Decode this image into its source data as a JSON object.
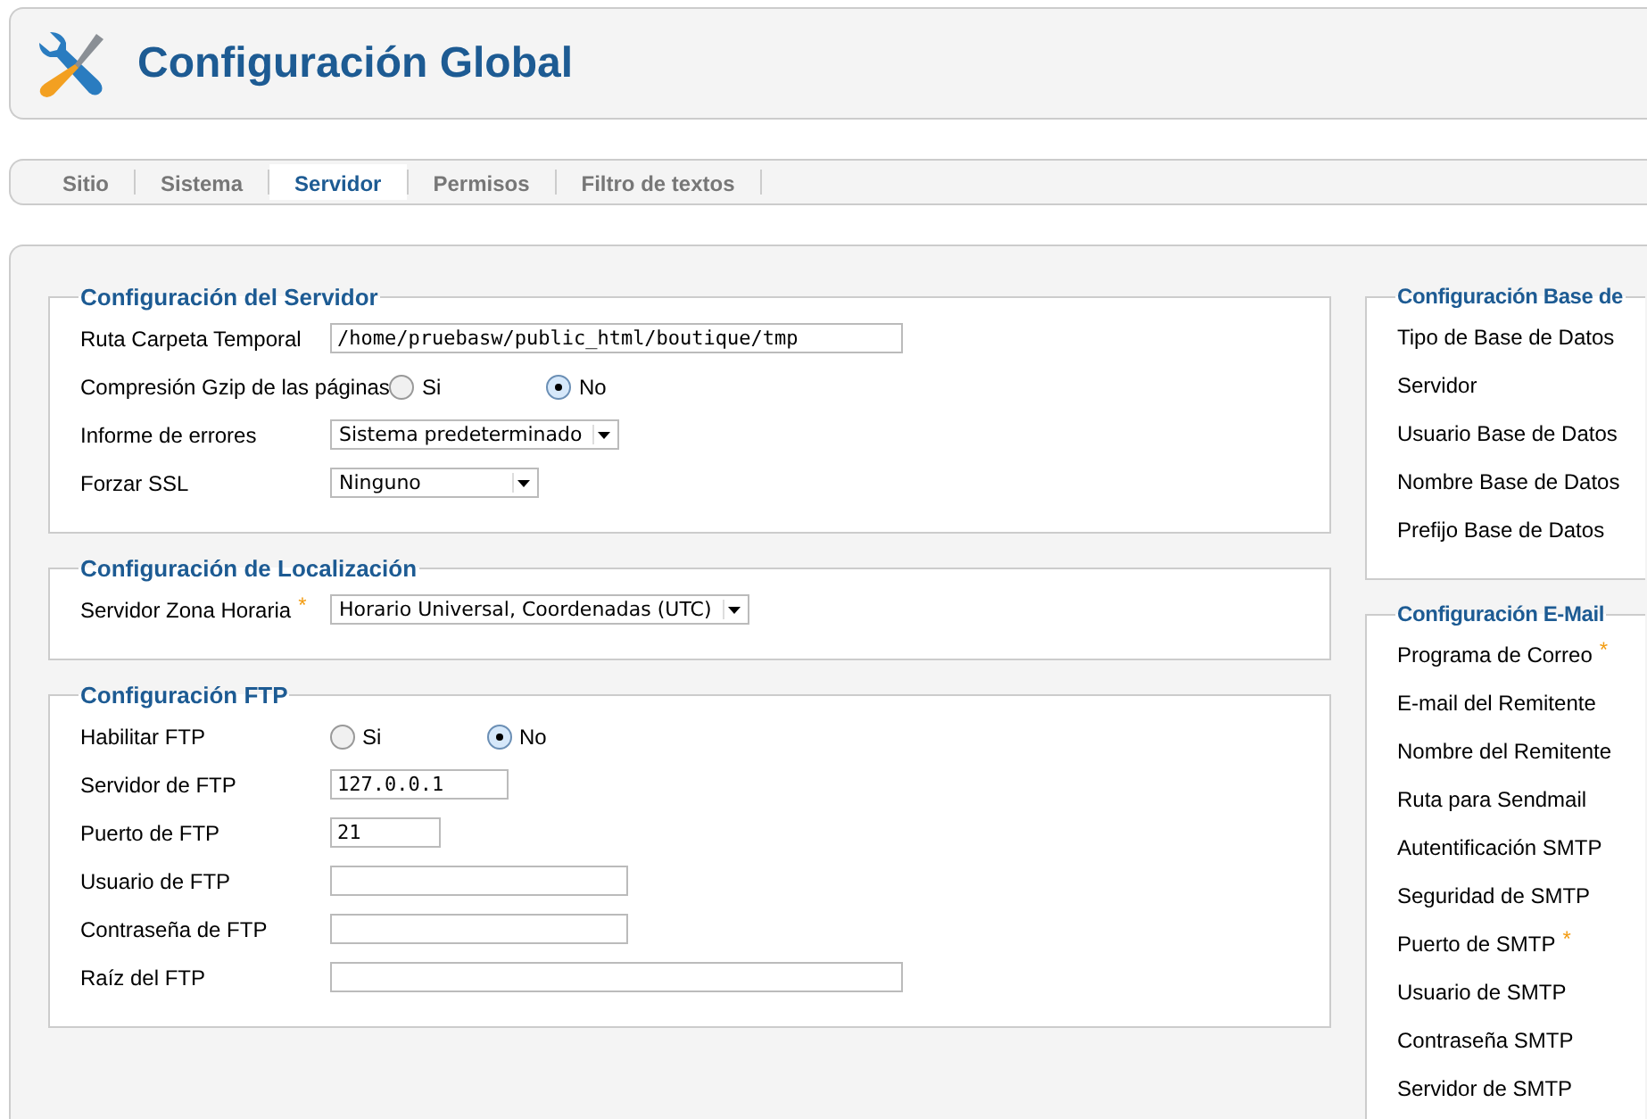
{
  "header": {
    "title": "Configuración Global"
  },
  "tabs": [
    {
      "label": "Sitio",
      "selected": false
    },
    {
      "label": "Sistema",
      "selected": false
    },
    {
      "label": "Servidor",
      "selected": true
    },
    {
      "label": "Permisos",
      "selected": false
    },
    {
      "label": "Filtro de textos",
      "selected": false
    }
  ],
  "left_sections": [
    {
      "legend": "Configuración del Servidor",
      "fields": [
        {
          "kind": "text",
          "label": "Ruta Carpeta Temporal",
          "value": "/home/pruebasw/public_html/boutique/tmp"
        },
        {
          "kind": "radio",
          "label": "Compresión Gzip de las páginas",
          "options": [
            {
              "label": "Si",
              "selected": false
            },
            {
              "label": "No",
              "selected": true
            }
          ]
        },
        {
          "kind": "select",
          "label": "Informe de errores",
          "value": "Sistema predeterminado"
        },
        {
          "kind": "select",
          "label": "Forzar SSL",
          "value": "Ninguno"
        }
      ]
    },
    {
      "legend": "Configuración de Localización",
      "fields": [
        {
          "kind": "select",
          "label": "Servidor Zona Horaria",
          "marker": "*",
          "value": "Horario Universal, Coordenadas (UTC)"
        }
      ]
    },
    {
      "legend": "Configuración FTP",
      "fields": [
        {
          "kind": "radio",
          "label": "Habilitar FTP",
          "options": [
            {
              "label": "Si",
              "selected": false
            },
            {
              "label": "No",
              "selected": true
            }
          ]
        },
        {
          "kind": "text",
          "label": "Servidor de FTP",
          "value": "127.0.0.1"
        },
        {
          "kind": "text",
          "label": "Puerto de FTP",
          "value": "21"
        },
        {
          "kind": "text",
          "label": "Usuario de FTP"
        },
        {
          "kind": "text",
          "label": "Contraseña de FTP"
        },
        {
          "kind": "text",
          "label": "Raíz del FTP"
        }
      ]
    }
  ],
  "right_sections": [
    {
      "legend": "Configuración Base de",
      "fields": [
        {
          "label": "Tipo de Base de Datos"
        },
        {
          "label": "Servidor"
        },
        {
          "label": "Usuario Base de Datos"
        },
        {
          "label": "Nombre Base de Datos"
        },
        {
          "label": "Prefijo Base de Datos"
        }
      ]
    },
    {
      "legend": "Configuración E-Mail",
      "fields": [
        {
          "label": "Programa de Correo",
          "marker": "*"
        },
        {
          "label": "E-mail del Remitente"
        },
        {
          "label": "Nombre del Remitente"
        },
        {
          "label": "Ruta para Sendmail"
        },
        {
          "label": "Autentificación SMTP"
        },
        {
          "label": "Seguridad de SMTP"
        },
        {
          "label": "Puerto de SMTP",
          "marker": "*"
        },
        {
          "label": "Usuario de SMTP"
        },
        {
          "label": "Contraseña SMTP"
        },
        {
          "label": "Servidor de SMTP"
        }
      ]
    }
  ]
}
